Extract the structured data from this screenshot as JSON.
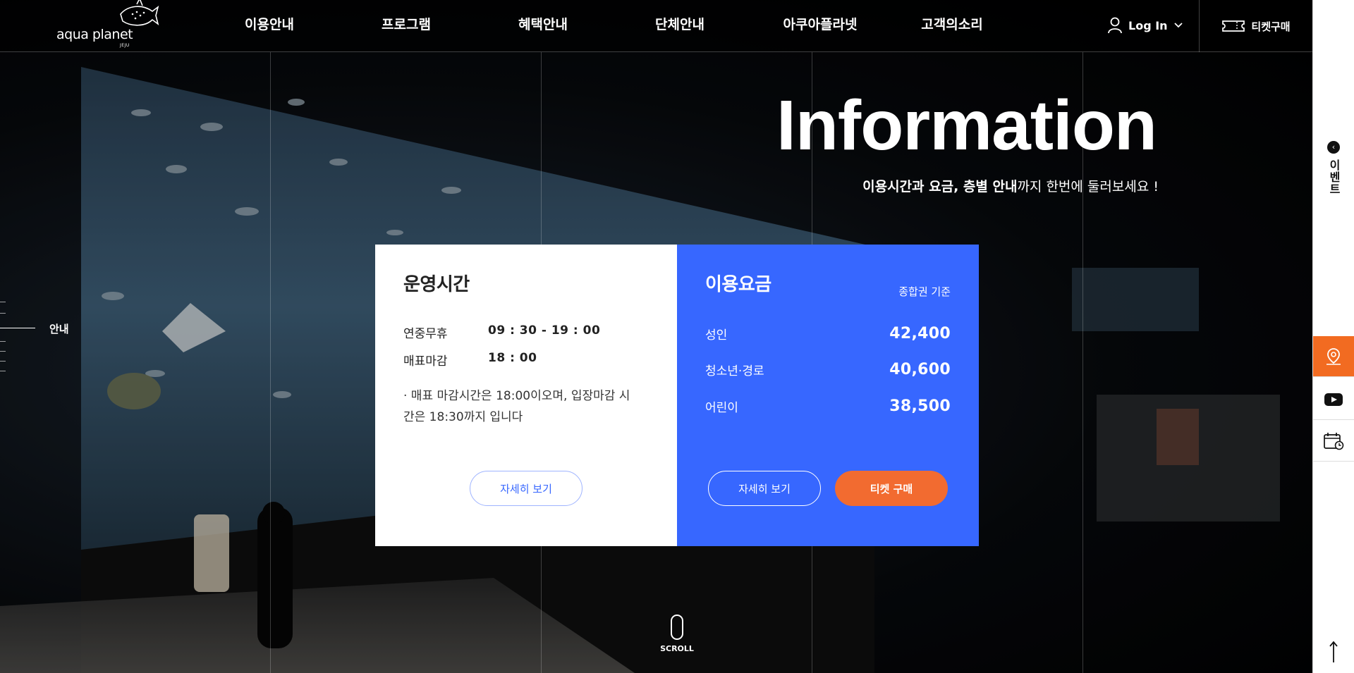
{
  "header": {
    "logo_text": "aqua planet",
    "logo_sub": "JEJU",
    "nav": [
      "이용안내",
      "프로그램",
      "혜택안내",
      "단체안내",
      "아쿠아플라넷",
      "고객의소리"
    ],
    "login_label": "Log In",
    "ticket_label": "티켓구매"
  },
  "rail": {
    "event_label": "이벤트"
  },
  "indicator": {
    "active_label": "안내"
  },
  "hero": {
    "title": "Information",
    "subtitle_bold": "이용시간과 요금, 층별 안내",
    "subtitle_rest": "까지 한번에 둘러보세요 !"
  },
  "hours": {
    "title": "운영시간",
    "rows": [
      {
        "label": "연중무휴",
        "value": "09 : 30 - 19 : 00"
      },
      {
        "label": "매표마감",
        "value": "18 : 00"
      }
    ],
    "note": "· 매표 마감시간은 18:00이오며, 입장마감 시간은 18:30까지 입니다",
    "detail_button": "자세히 보기"
  },
  "fees": {
    "title": "이용요금",
    "basis": "종합권 기준",
    "rows": [
      {
        "label": "성인",
        "value": "42,400"
      },
      {
        "label": "청소년·경로",
        "value": "40,600"
      },
      {
        "label": "어린이",
        "value": "38,500"
      }
    ],
    "detail_button": "자세히 보기",
    "buy_button": "티켓 구매"
  },
  "scroll_label": "SCROLL",
  "colors": {
    "fee_card": "#3767ff",
    "buy_button": "#f26b30",
    "map_rail": "#f26b21"
  }
}
